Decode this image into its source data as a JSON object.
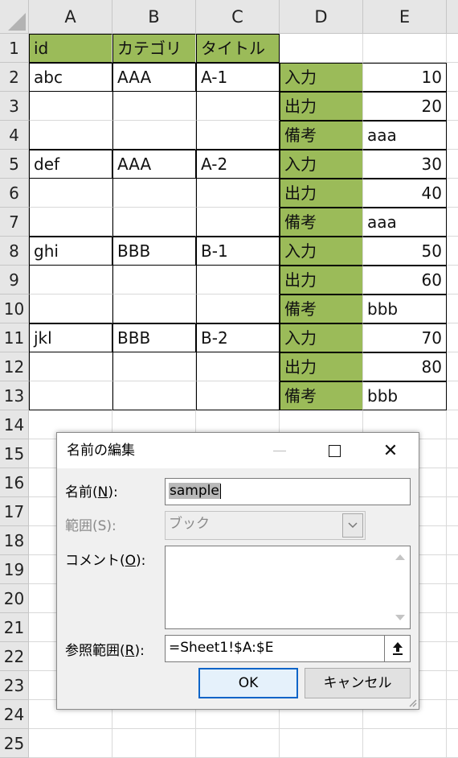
{
  "sheet": {
    "columns": [
      "A",
      "B",
      "C",
      "D",
      "E"
    ],
    "rows": [
      "1",
      "2",
      "3",
      "4",
      "5",
      "6",
      "7",
      "8",
      "9",
      "10",
      "11",
      "12",
      "13",
      "14",
      "15",
      "16",
      "17",
      "18",
      "19",
      "20",
      "21",
      "22",
      "23",
      "24",
      "25"
    ],
    "header": {
      "A": "id",
      "B": "カテゴリ",
      "C": "タイトル"
    },
    "records": [
      {
        "id": "abc",
        "category": "AAA",
        "title": "A-1",
        "input_label": "入力",
        "input": "10",
        "output_label": "出力",
        "output": "20",
        "note_label": "備考",
        "note": "aaa"
      },
      {
        "id": "def",
        "category": "AAA",
        "title": "A-2",
        "input_label": "入力",
        "input": "30",
        "output_label": "出力",
        "output": "40",
        "note_label": "備考",
        "note": "aaa"
      },
      {
        "id": "ghi",
        "category": "BBB",
        "title": "B-1",
        "input_label": "入力",
        "input": "50",
        "output_label": "出力",
        "output": "60",
        "note_label": "備考",
        "note": "bbb"
      },
      {
        "id": "jkl",
        "category": "BBB",
        "title": "B-2",
        "input_label": "入力",
        "input": "70",
        "output_label": "出力",
        "output": "80",
        "note_label": "備考",
        "note": "bbb"
      }
    ],
    "accent_color": "#9bbb59"
  },
  "dialog": {
    "title": "名前の編集",
    "name_label": "名前(",
    "name_key": "N",
    "name_label_end": "):",
    "name_value": "sample",
    "scope_label": "範囲(S):",
    "scope_value": "ブック",
    "comment_label": "コメント(",
    "comment_key": "O",
    "comment_label_end": "):",
    "ref_label": "参照範囲(",
    "ref_key": "R",
    "ref_label_end": "):",
    "ref_value": "=Sheet1!$A:$E",
    "ok_label": "OK",
    "cancel_label": "キャンセル",
    "close_glyph": "✕"
  }
}
